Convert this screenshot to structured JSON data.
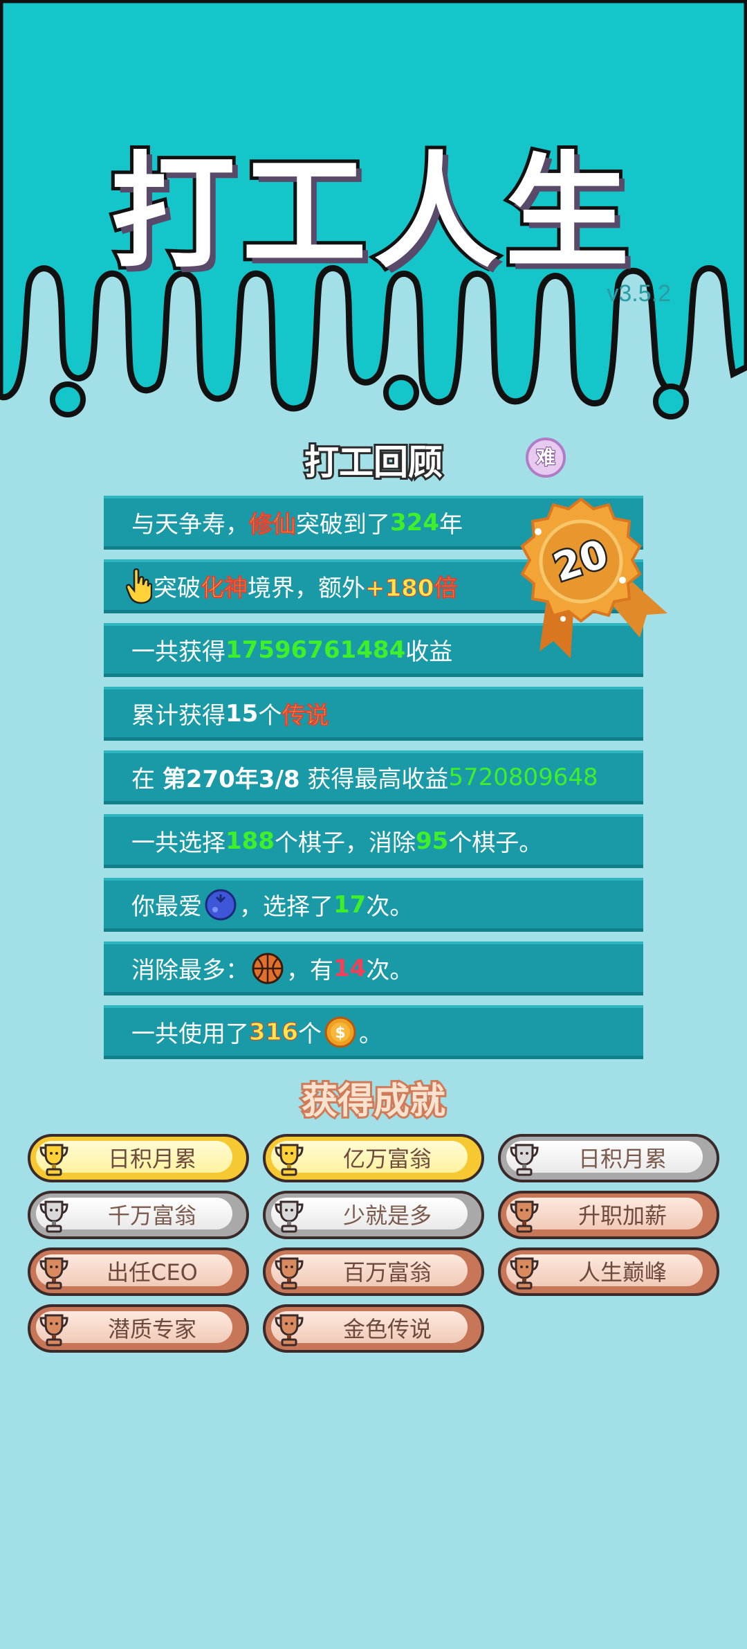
{
  "header": {
    "title": "打工人生",
    "version": "v3.5.2"
  },
  "review": {
    "title": "打工回顾",
    "difficulty_badge": "难",
    "rank_medal": "20",
    "rows": [
      {
        "parts": [
          {
            "t": "与天争寿，",
            "c": ""
          },
          {
            "t": "修仙",
            "c": "y"
          },
          {
            "t": "突破到了",
            "c": ""
          },
          {
            "t": "324",
            "c": "g"
          },
          {
            "t": "年",
            "c": ""
          }
        ]
      },
      {
        "parts": [
          {
            "t": "突破",
            "c": ""
          },
          {
            "t": "化神",
            "c": "y"
          },
          {
            "t": "境界，额外",
            "c": ""
          },
          {
            "t": "+180倍",
            "c": "y"
          }
        ],
        "icon": "pointing-hand-icon"
      },
      {
        "parts": [
          {
            "t": "一共获得",
            "c": ""
          },
          {
            "t": "17596761484",
            "c": "g"
          },
          {
            "t": "收益",
            "c": ""
          }
        ]
      },
      {
        "parts": [
          {
            "t": "累计获得",
            "c": ""
          },
          {
            "t": "15",
            "c": "w"
          },
          {
            "t": "个",
            "c": ""
          },
          {
            "t": "传说",
            "c": "y"
          }
        ]
      },
      {
        "parts": [
          {
            "t": "在 ",
            "c": ""
          },
          {
            "t": "第270年3/8",
            "c": "w"
          },
          {
            "t": " 获得最高收益",
            "c": ""
          },
          {
            "t": "5720809648",
            "c": "gt"
          }
        ]
      },
      {
        "parts": [
          {
            "t": "一共选择",
            "c": ""
          },
          {
            "t": "188",
            "c": "g"
          },
          {
            "t": "个棋子，消除",
            "c": ""
          },
          {
            "t": "95",
            "c": "g"
          },
          {
            "t": "个棋子。",
            "c": ""
          }
        ]
      },
      {
        "parts": [
          {
            "t": "你最爱",
            "c": ""
          },
          {
            "icon": "blueberry-icon"
          },
          {
            "t": "，选择了",
            "c": ""
          },
          {
            "t": "17",
            "c": "g"
          },
          {
            "t": "次。",
            "c": ""
          }
        ]
      },
      {
        "parts": [
          {
            "t": "消除最多：",
            "c": ""
          },
          {
            "icon": "basketball-icon"
          },
          {
            "t": "，有",
            "c": ""
          },
          {
            "t": "14",
            "c": "r"
          },
          {
            "t": "次。",
            "c": ""
          }
        ]
      },
      {
        "parts": [
          {
            "t": "一共使用了",
            "c": ""
          },
          {
            "t": "316",
            "c": "y"
          },
          {
            "t": "个",
            "c": ""
          },
          {
            "icon": "coin-icon"
          },
          {
            "t": "。",
            "c": ""
          }
        ]
      }
    ]
  },
  "achievements": {
    "title": "获得成就",
    "items": [
      {
        "label": "日积月累",
        "tier": "gold"
      },
      {
        "label": "亿万富翁",
        "tier": "gold"
      },
      {
        "label": "日积月累",
        "tier": "silver"
      },
      {
        "label": "千万富翁",
        "tier": "silver"
      },
      {
        "label": "少就是多",
        "tier": "silver"
      },
      {
        "label": "升职加薪",
        "tier": "bronze"
      },
      {
        "label": "出任CEO",
        "tier": "bronze"
      },
      {
        "label": "百万富翁",
        "tier": "bronze"
      },
      {
        "label": "人生巅峰",
        "tier": "bronze"
      },
      {
        "label": "潜质专家",
        "tier": "bronze"
      },
      {
        "label": "金色传说",
        "tier": "bronze"
      }
    ]
  },
  "colors": {
    "header_bg": "#14c6c9",
    "page_bg": "#a3dfe6",
    "row_bg": "#1a9aa6",
    "green": "#3df02a",
    "yellow": "#ffe94a"
  }
}
